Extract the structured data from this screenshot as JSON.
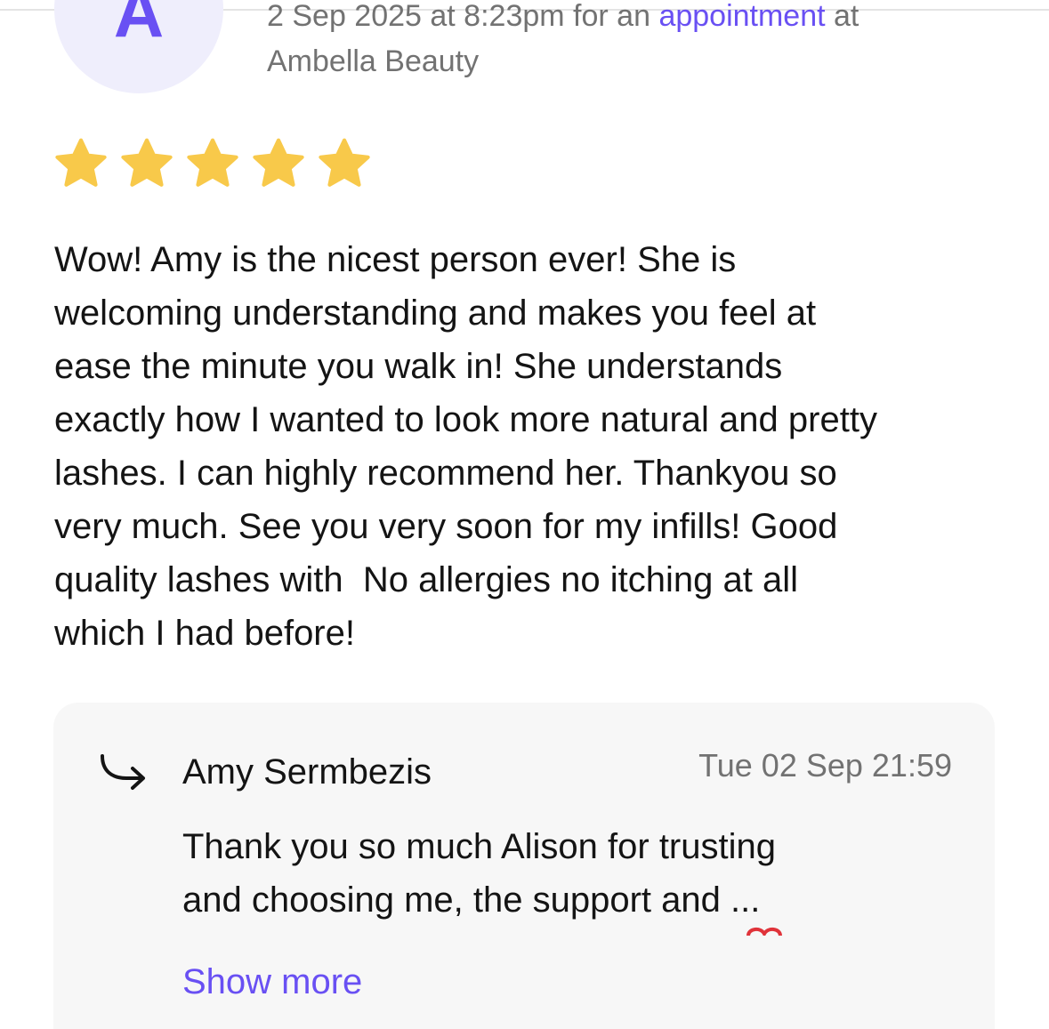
{
  "review": {
    "avatar_initial": "A",
    "meta_line1_prefix": "2 Sep 2025 at 8:23pm for an ",
    "meta_link": "appointment",
    "meta_line1_suffix": " at",
    "meta_line2": "Ambella Beauty",
    "rating": 5,
    "rating_max": 5,
    "text": "Wow! Amy is the nicest person ever! She is\nwelcoming understanding and makes you feel at\nease the minute you walk in! She understands\nexactly how I wanted to look more natural and pretty\nlashes. I can highly recommend her. Thankyou so\nvery much. See you very soon for my infills! Good\nquality lashes with  No allergies no itching at all\nwhich I had before!"
  },
  "reply": {
    "author": "Amy Sermbezis",
    "date": "Tue 02 Sep 21:59",
    "text": "Thank you so much Alison for trusting\nand choosing me, the support and ...",
    "show_more_label": "Show more"
  },
  "colors": {
    "accent": "#6950f3",
    "star": "#f8c94a",
    "muted_text": "#727272",
    "avatar_bg": "#efeefc",
    "card_bg": "#f7f7f7"
  },
  "icons": {
    "reply": "reply-arrow-icon",
    "star": "star-icon"
  }
}
